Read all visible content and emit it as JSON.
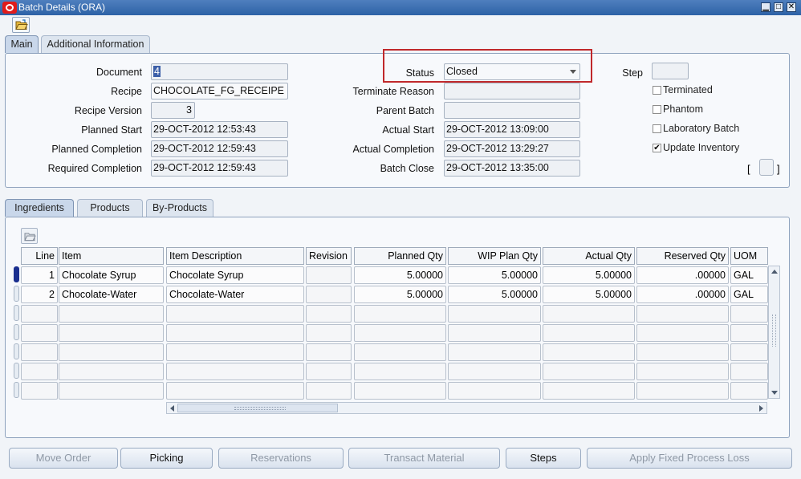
{
  "window": {
    "title": "Batch Details (ORA)",
    "controls": {
      "minimize": "▁",
      "maximize": "□",
      "close": "✕"
    }
  },
  "tabs": [
    {
      "label": "Main",
      "active": true
    },
    {
      "label": "Additional Information",
      "active": false
    }
  ],
  "main": {
    "document_label": "Document",
    "document_value": "4",
    "recipe_label": "Recipe",
    "recipe_value": "CHOCOLATE_FG_RECEIPE",
    "recipe_version_label": "Recipe Version",
    "recipe_version_value": "3",
    "planned_start_label": "Planned Start",
    "planned_start_value": "29-OCT-2012 12:53:43",
    "planned_completion_label": "Planned Completion",
    "planned_completion_value": "29-OCT-2012 12:59:43",
    "required_completion_label": "Required Completion",
    "required_completion_value": "29-OCT-2012 12:59:43",
    "status_label": "Status",
    "status_value": "Closed",
    "terminate_reason_label": "Terminate Reason",
    "terminate_reason_value": "",
    "parent_batch_label": "Parent Batch",
    "parent_batch_value": "",
    "actual_start_label": "Actual Start",
    "actual_start_value": "29-OCT-2012 13:09:00",
    "actual_completion_label": "Actual Completion",
    "actual_completion_value": "29-OCT-2012 13:29:27",
    "batch_close_label": "Batch Close",
    "batch_close_value": "29-OCT-2012 13:35:00",
    "step_label": "Step",
    "step_value": "",
    "checkboxes": [
      {
        "label": "Terminated",
        "checked": false
      },
      {
        "label": "Phantom",
        "checked": false
      },
      {
        "label": "Laboratory Batch",
        "checked": false
      },
      {
        "label": "Update Inventory",
        "checked": true
      }
    ],
    "bracket_left": "[",
    "bracket_right": "]"
  },
  "lower_tabs": [
    {
      "label": "Ingredients",
      "active": true
    },
    {
      "label": "Products",
      "active": false
    },
    {
      "label": "By-Products",
      "active": false
    }
  ],
  "grid": {
    "headers": [
      "Line",
      "Item",
      "Item Description",
      "Revision",
      "Planned Qty",
      "WIP Plan Qty",
      "Actual Qty",
      "Reserved Qty",
      "UOM"
    ],
    "rows": [
      [
        "1",
        "Chocolate Syrup",
        "Chocolate Syrup",
        "",
        "5.00000",
        "5.00000",
        "5.00000",
        ".00000",
        "GAL"
      ],
      [
        "2",
        "Chocolate-Water",
        "Chocolate-Water",
        "",
        "5.00000",
        "5.00000",
        "5.00000",
        ".00000",
        "GAL"
      ],
      [
        "",
        "",
        "",
        "",
        "",
        "",
        "",
        "",
        ""
      ],
      [
        "",
        "",
        "",
        "",
        "",
        "",
        "",
        "",
        ""
      ],
      [
        "",
        "",
        "",
        "",
        "",
        "",
        "",
        "",
        ""
      ],
      [
        "",
        "",
        "",
        "",
        "",
        "",
        "",
        "",
        ""
      ],
      [
        "",
        "",
        "",
        "",
        "",
        "",
        "",
        "",
        ""
      ]
    ]
  },
  "buttons": [
    {
      "label": "Move Order",
      "enabled": false
    },
    {
      "label": "Picking",
      "enabled": true
    },
    {
      "label": "Reservations",
      "enabled": false
    },
    {
      "label": "Transact Material",
      "enabled": false
    },
    {
      "label": "Steps",
      "enabled": true
    },
    {
      "label": "Apply Fixed Process Loss",
      "enabled": false
    }
  ],
  "colors": {
    "title_bar": "#2d62a6",
    "highlight_box": "#c0282b",
    "current_row": "#1a2f8f"
  },
  "icons": [
    "oracle-logo-icon",
    "folder-open-icon",
    "scroll-up-icon",
    "scroll-down-icon",
    "scroll-left-icon",
    "scroll-right-icon",
    "dropdown-arrow-icon"
  ]
}
